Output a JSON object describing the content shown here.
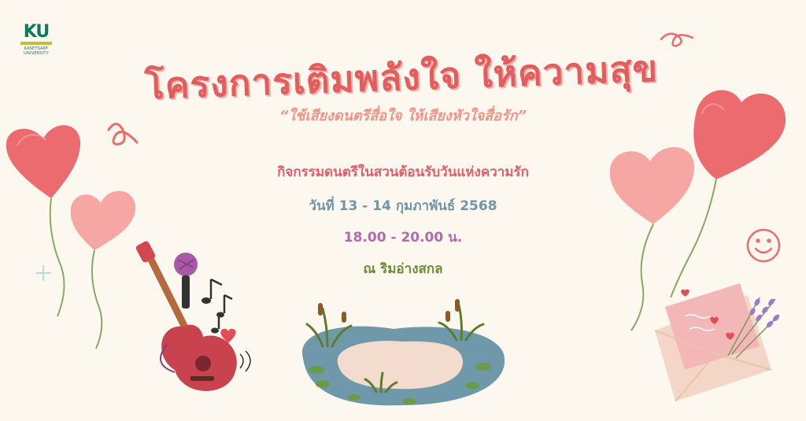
{
  "logo": {
    "mark": "KU",
    "org_line1": "KASETSART",
    "org_line2": "UNIVERSITY"
  },
  "poster": {
    "title": "โครงการเติมพลังใจ ให้ความสุข",
    "subtitle": "“ใช้เสียงดนตรีสื่อใจ ให้เสียงหัวใจสื่อรัก”",
    "activity": "กิจกรรมดนตรีในสวนต้อนรับวันแห่งความรัก",
    "date": "วันที่ 13 - 14 กุมภาพันธ์ 2568",
    "time": "18.00 - 20.00 น.",
    "place": "ณ ริมอ่างสกล"
  },
  "colors": {
    "background": "#fdf8ef",
    "title": "#e25d5d",
    "subtitle": "#f29386",
    "activity": "#e65b6a",
    "date": "#6f95a7",
    "time": "#b26aa8",
    "place": "#6e8a3a",
    "balloon_red": "#ec6b6f",
    "balloon_pink": "#f6a7a4",
    "pond": "#6f98aa"
  },
  "icons": [
    "heart-balloon-icon",
    "guitar-icon",
    "microphone-icon",
    "music-notes-icon",
    "pond-icon",
    "envelope-icon",
    "lavender-icon",
    "smiley-icon",
    "sparkle-icon",
    "squiggle-icon"
  ]
}
